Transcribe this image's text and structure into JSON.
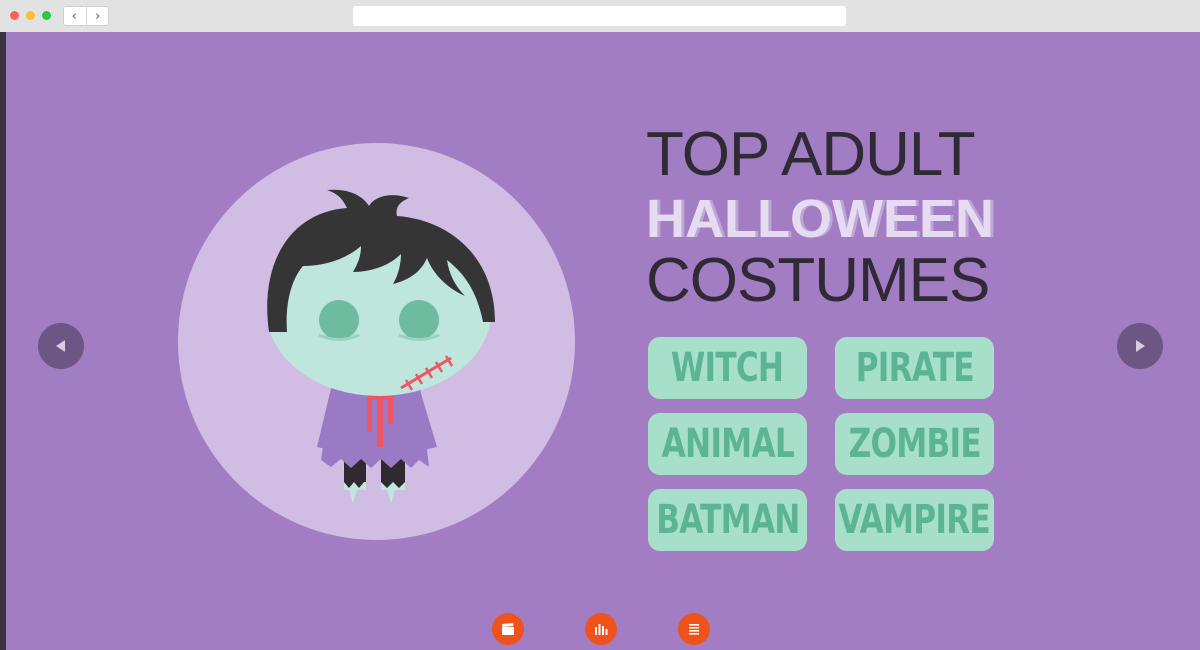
{
  "browser": {
    "nav_back": "‹",
    "nav_forward": "›"
  },
  "hero": {
    "title_line1": "TOP ADULT",
    "title_line2": "HALLOWEEN",
    "title_line3": "COSTUMES"
  },
  "costumes": [
    "WITCH",
    "PIRATE",
    "ANIMAL",
    "ZOMBIE",
    "BATMAN",
    "VAMPIRE"
  ],
  "colors": {
    "page_background": "#a37dc3",
    "circle": "#d1bde3",
    "tag_background": "#a8dfcb",
    "tag_text": "#5cb592",
    "arrow_button": "#6d5683",
    "bottom_icon": "#f0521b"
  },
  "icons": {
    "prev": "arrow-left-icon",
    "next": "arrow-right-icon",
    "bottom": [
      "clapperboard-icon",
      "bar-chart-icon",
      "document-icon"
    ]
  }
}
